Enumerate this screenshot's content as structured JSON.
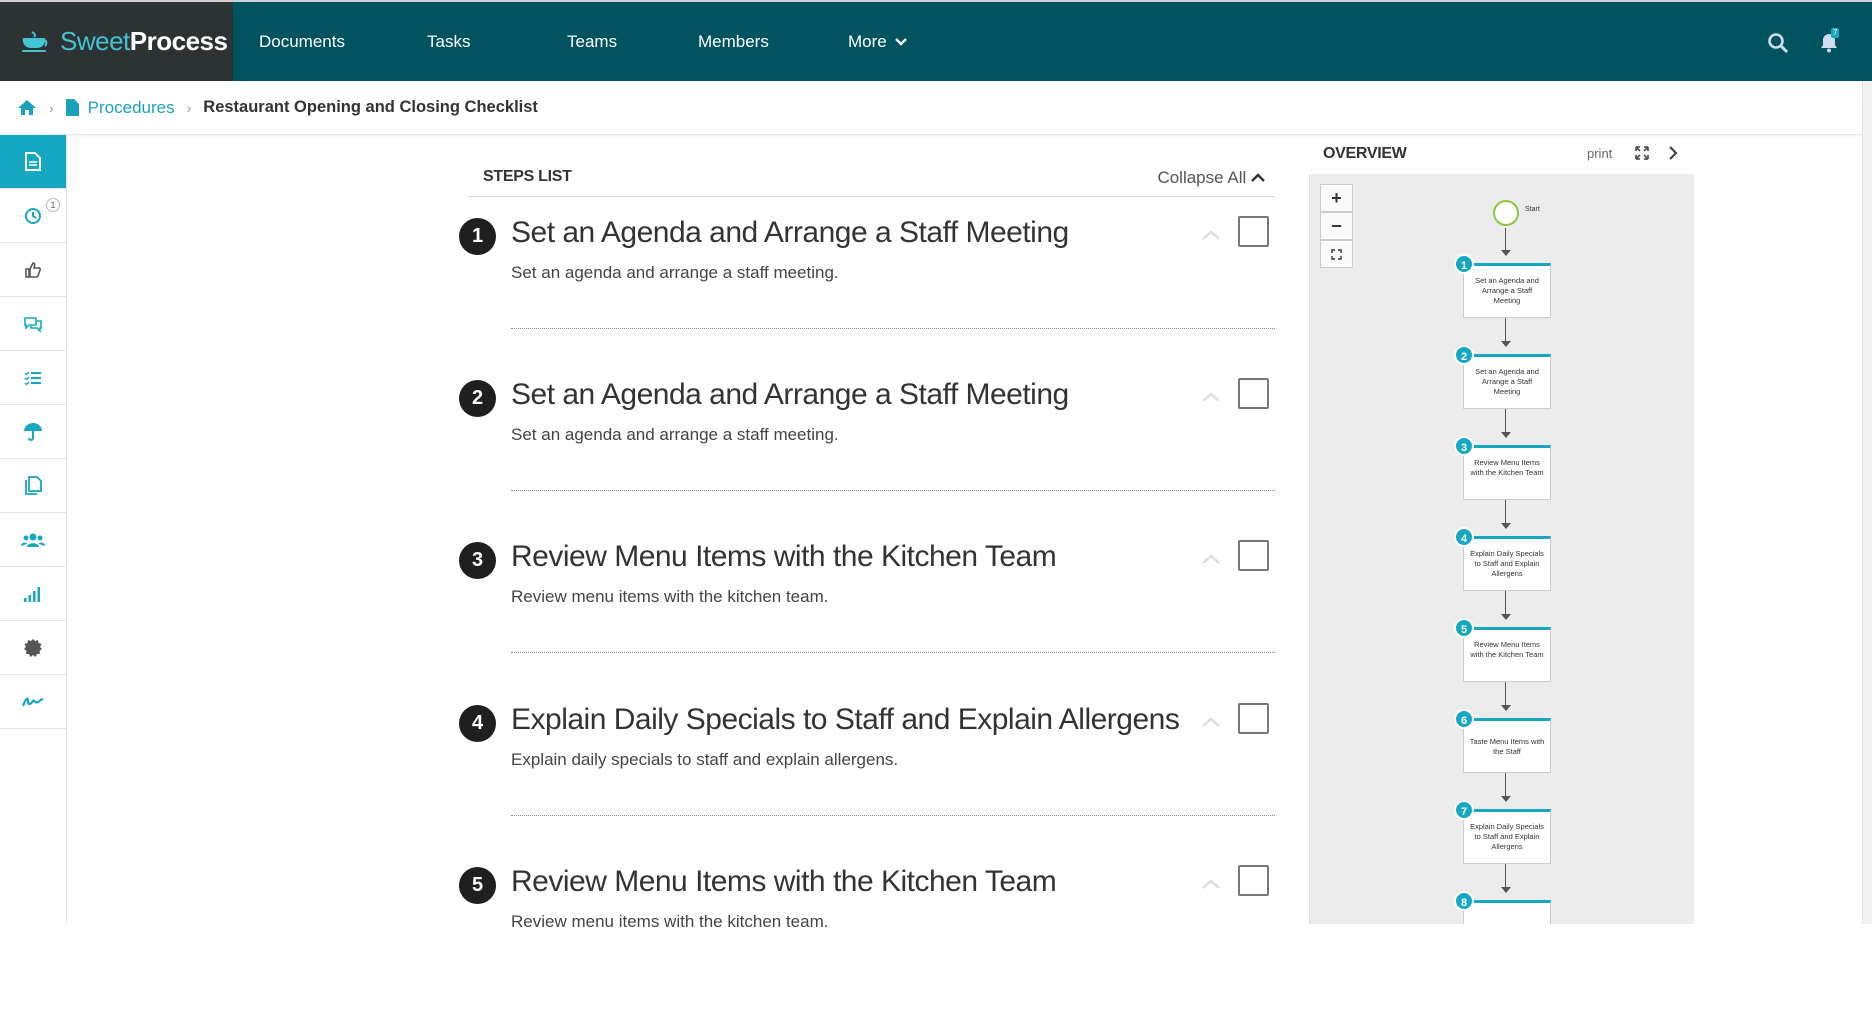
{
  "nav": {
    "brand_part1": "Sweet",
    "brand_part2": "Process",
    "items": [
      "Documents",
      "Tasks",
      "Teams",
      "Members",
      "More"
    ],
    "icons": [
      "search-icon",
      "bell-icon"
    ],
    "notification_count": "7"
  },
  "breadcrumb": {
    "home_icon": "home-icon",
    "procedures_label": "Procedures",
    "current": "Restaurant Opening and Closing Checklist"
  },
  "sidebar": {
    "items": [
      {
        "icon": "document-icon",
        "active": true
      },
      {
        "icon": "clock-icon",
        "badge": "1"
      },
      {
        "icon": "thumbs-up-icon"
      },
      {
        "icon": "comments-icon"
      },
      {
        "icon": "checklist-icon"
      },
      {
        "icon": "umbrella-icon"
      },
      {
        "icon": "copy-icon"
      },
      {
        "icon": "users-icon"
      },
      {
        "icon": "signal-icon"
      },
      {
        "icon": "seal-icon"
      },
      {
        "icon": "signature-icon"
      }
    ]
  },
  "steps": {
    "header": "STEPS LIST",
    "collapse_all": "Collapse All",
    "items": [
      {
        "num": "1",
        "title": "Set an Agenda and Arrange a Staff Meeting",
        "desc": "Set an agenda and arrange a staff meeting."
      },
      {
        "num": "2",
        "title": "Set an Agenda and Arrange a Staff Meeting",
        "desc": "Set an agenda and arrange a staff meeting."
      },
      {
        "num": "3",
        "title": "Review Menu Items with the Kitchen Team",
        "desc": "Review menu items with the kitchen team."
      },
      {
        "num": "4",
        "title": "Explain Daily Specials to Staff and Explain Allergens",
        "desc": "Explain daily specials to staff and explain allergens."
      },
      {
        "num": "5",
        "title": "Review Menu Items with the Kitchen Team",
        "desc": "Review menu items with the kitchen team."
      }
    ]
  },
  "overview": {
    "title": "OVERVIEW",
    "print": "print",
    "zoom_in": "+",
    "zoom_out": "−",
    "start_label": "Start",
    "nodes": [
      {
        "num": "1",
        "text": "Set an Agenda and Arrange a Staff Meeting"
      },
      {
        "num": "2",
        "text": "Set an Agenda and Arrange a Staff Meeting"
      },
      {
        "num": "3",
        "text": "Review Menu Items with the Kitchen Team"
      },
      {
        "num": "4",
        "text": "Explain Daily Specials to Staff and Explain Allergens"
      },
      {
        "num": "5",
        "text": "Review Menu Items with the Kitchen Team"
      },
      {
        "num": "6",
        "text": "Taste Menu Items with the Staff"
      },
      {
        "num": "7",
        "text": "Explain Daily Specials to Staff and Explain Allergens"
      },
      {
        "num": "8",
        "text": ""
      }
    ]
  },
  "colors": {
    "nav_bg": "#00535f",
    "brand_bg": "#2d3234",
    "accent": "#16a8c1",
    "start_green": "#8dc63f"
  }
}
